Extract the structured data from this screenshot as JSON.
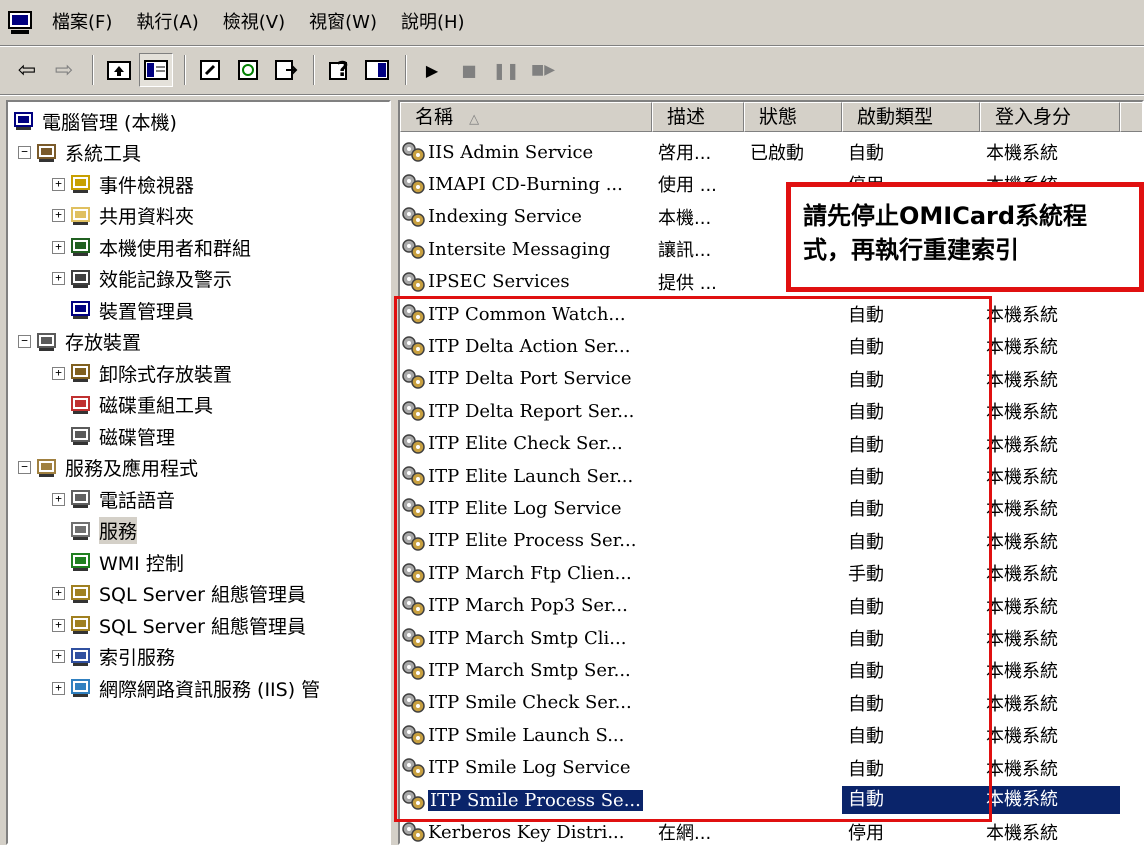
{
  "menu": [
    "檔案(F)",
    "執行(A)",
    "檢視(V)",
    "視窗(W)",
    "說明(H)"
  ],
  "tree": [
    {
      "label": "電腦管理 (本機)",
      "depth": 0,
      "expander": "",
      "icon": "computer-icon"
    },
    {
      "label": "系統工具",
      "depth": 1,
      "expander": "-",
      "icon": "tools-icon"
    },
    {
      "label": "事件檢視器",
      "depth": 2,
      "expander": "+",
      "icon": "event-viewer-icon"
    },
    {
      "label": "共用資料夾",
      "depth": 2,
      "expander": "+",
      "icon": "shared-folder-icon"
    },
    {
      "label": "本機使用者和群組",
      "depth": 2,
      "expander": "+",
      "icon": "users-icon"
    },
    {
      "label": "效能記錄及警示",
      "depth": 2,
      "expander": "+",
      "icon": "performance-icon"
    },
    {
      "label": "裝置管理員",
      "depth": 2,
      "expander": "",
      "icon": "device-manager-icon"
    },
    {
      "label": "存放裝置",
      "depth": 1,
      "expander": "-",
      "icon": "storage-icon"
    },
    {
      "label": "卸除式存放裝置",
      "depth": 2,
      "expander": "+",
      "icon": "removable-storage-icon"
    },
    {
      "label": "磁碟重組工具",
      "depth": 2,
      "expander": "",
      "icon": "defrag-icon"
    },
    {
      "label": "磁碟管理",
      "depth": 2,
      "expander": "",
      "icon": "disk-management-icon"
    },
    {
      "label": "服務及應用程式",
      "depth": 1,
      "expander": "-",
      "icon": "services-apps-icon"
    },
    {
      "label": "電話語音",
      "depth": 2,
      "expander": "+",
      "icon": "telephony-icon"
    },
    {
      "label": "服務",
      "depth": 2,
      "expander": "",
      "icon": "services-gear-icon",
      "selected": true
    },
    {
      "label": "WMI 控制",
      "depth": 2,
      "expander": "",
      "icon": "wmi-icon"
    },
    {
      "label": "SQL Server 組態管理員",
      "depth": 2,
      "expander": "+",
      "icon": "sql-server-icon"
    },
    {
      "label": "SQL Server 組態管理員",
      "depth": 2,
      "expander": "+",
      "icon": "sql-server-icon"
    },
    {
      "label": "索引服務",
      "depth": 2,
      "expander": "+",
      "icon": "indexing-icon"
    },
    {
      "label": "網際網路資訊服務 (IIS) 管",
      "depth": 2,
      "expander": "+",
      "icon": "iis-icon"
    }
  ],
  "columns": [
    "名稱",
    "描述",
    "狀態",
    "啟動類型",
    "登入身分"
  ],
  "sort_indicator": "△",
  "rows": [
    {
      "name": "IIS Admin Service",
      "desc": "啓用...",
      "status": "已啟動",
      "startup": "自動",
      "logon": "本機系統"
    },
    {
      "name": "IMAPI CD-Burning ...",
      "desc": "使用 ...",
      "status": "",
      "startup": "停用",
      "logon": "本機系統"
    },
    {
      "name": "Indexing Service",
      "desc": "本機...",
      "status": "",
      "startup": "",
      "logon": ""
    },
    {
      "name": "Intersite Messaging",
      "desc": "讓訊...",
      "status": "",
      "startup": "",
      "logon": ""
    },
    {
      "name": "IPSEC Services",
      "desc": "提供 ...",
      "status": "",
      "startup": "",
      "logon": ""
    },
    {
      "name": "ITP Common Watch...",
      "desc": "",
      "status": "",
      "startup": "自動",
      "logon": "本機系統"
    },
    {
      "name": "ITP Delta Action Ser...",
      "desc": "",
      "status": "",
      "startup": "自動",
      "logon": "本機系統"
    },
    {
      "name": "ITP Delta Port Service",
      "desc": "",
      "status": "",
      "startup": "自動",
      "logon": "本機系統"
    },
    {
      "name": "ITP Delta Report Ser...",
      "desc": "",
      "status": "",
      "startup": "自動",
      "logon": "本機系統"
    },
    {
      "name": "ITP Elite Check Ser...",
      "desc": "",
      "status": "",
      "startup": "自動",
      "logon": "本機系統"
    },
    {
      "name": "ITP Elite Launch Ser...",
      "desc": "",
      "status": "",
      "startup": "自動",
      "logon": "本機系統"
    },
    {
      "name": "ITP Elite Log Service",
      "desc": "",
      "status": "",
      "startup": "自動",
      "logon": "本機系統"
    },
    {
      "name": "ITP Elite Process Ser...",
      "desc": "",
      "status": "",
      "startup": "自動",
      "logon": "本機系統"
    },
    {
      "name": "ITP March Ftp Clien...",
      "desc": "",
      "status": "",
      "startup": "手動",
      "logon": "本機系統"
    },
    {
      "name": "ITP March Pop3 Ser...",
      "desc": "",
      "status": "",
      "startup": "自動",
      "logon": "本機系統"
    },
    {
      "name": "ITP March Smtp Cli...",
      "desc": "",
      "status": "",
      "startup": "自動",
      "logon": "本機系統"
    },
    {
      "name": "ITP March Smtp Ser...",
      "desc": "",
      "status": "",
      "startup": "自動",
      "logon": "本機系統"
    },
    {
      "name": "ITP Smile Check Ser...",
      "desc": "",
      "status": "",
      "startup": "自動",
      "logon": "本機系統"
    },
    {
      "name": "ITP Smile Launch S...",
      "desc": "",
      "status": "",
      "startup": "自動",
      "logon": "本機系統"
    },
    {
      "name": "ITP Smile Log Service",
      "desc": "",
      "status": "",
      "startup": "自動",
      "logon": "本機系統"
    },
    {
      "name": "ITP Smile Process Se...",
      "desc": "",
      "status": "",
      "startup": "自動",
      "logon": "本機系統",
      "selected": true
    },
    {
      "name": "Kerberos Key Distri...",
      "desc": "在網...",
      "status": "",
      "startup": "停用",
      "logon": "本機系統"
    }
  ],
  "callout": {
    "text": "請先停止OMICard系統程式，再執行重建索引"
  },
  "colors": {
    "highlight": "#e01010",
    "selection": "#0a246a"
  }
}
